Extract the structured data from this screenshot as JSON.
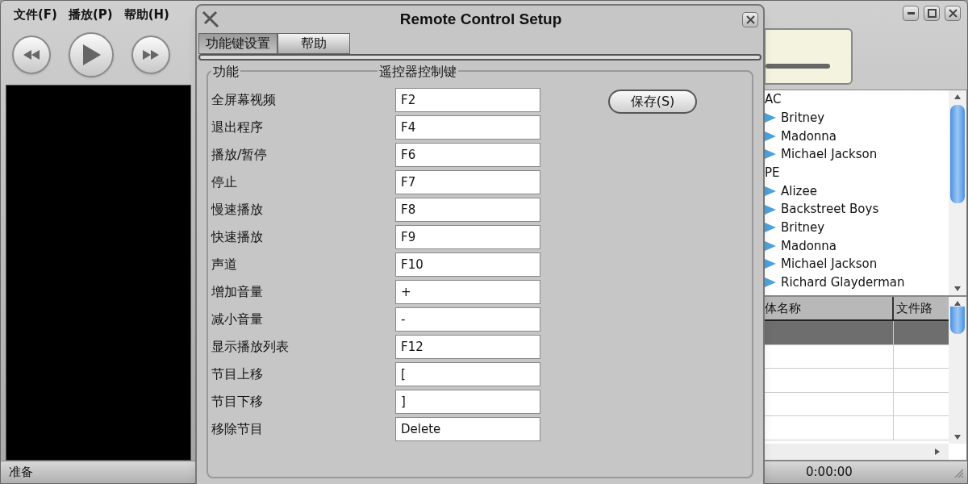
{
  "player": {
    "menu": [
      "文件(F)",
      "播放(P)",
      "帮助(H)"
    ],
    "status_left": "准备",
    "status_time": "0:00:00",
    "tree": [
      {
        "label": "AC",
        "children": [
          {
            "label": "Britney"
          },
          {
            "label": "Madonna"
          },
          {
            "label": "Michael Jackson"
          }
        ]
      },
      {
        "label": "PE",
        "children": [
          {
            "label": "Alizee"
          },
          {
            "label": "Backstreet Boys"
          },
          {
            "label": "Britney"
          },
          {
            "label": "Madonna"
          },
          {
            "label": "Michael Jackson"
          },
          {
            "label": "Richard Glayderman"
          }
        ]
      }
    ],
    "table": {
      "columns": [
        "体名称",
        "文件路"
      ],
      "rows": [
        {
          "selected": true
        },
        {
          "selected": false
        },
        {
          "selected": false
        },
        {
          "selected": false
        },
        {
          "selected": false
        }
      ]
    }
  },
  "dialog": {
    "title": "Remote Control Setup",
    "tabs": [
      {
        "label": "功能键设置",
        "selected": true
      },
      {
        "label": "帮助",
        "selected": false
      }
    ],
    "group_labels": [
      "功能",
      "遥控器控制键"
    ],
    "rows": [
      {
        "function": "全屏幕视频",
        "key": "F2"
      },
      {
        "function": "退出程序",
        "key": "F4"
      },
      {
        "function": "播放/暂停",
        "key": "F6"
      },
      {
        "function": "停止",
        "key": "F7"
      },
      {
        "function": "慢速播放",
        "key": "F8"
      },
      {
        "function": "快速播放",
        "key": "F9"
      },
      {
        "function": "声道",
        "key": "F10"
      },
      {
        "function": "增加音量",
        "key": "+"
      },
      {
        "function": "减小音量",
        "key": "-"
      },
      {
        "function": "显示播放列表",
        "key": "F12"
      },
      {
        "function": "节目上移",
        "key": "["
      },
      {
        "function": "节目下移",
        "key": "]"
      },
      {
        "function": "移除节目",
        "key": "Delete"
      }
    ],
    "save_button": "保存(S)"
  }
}
